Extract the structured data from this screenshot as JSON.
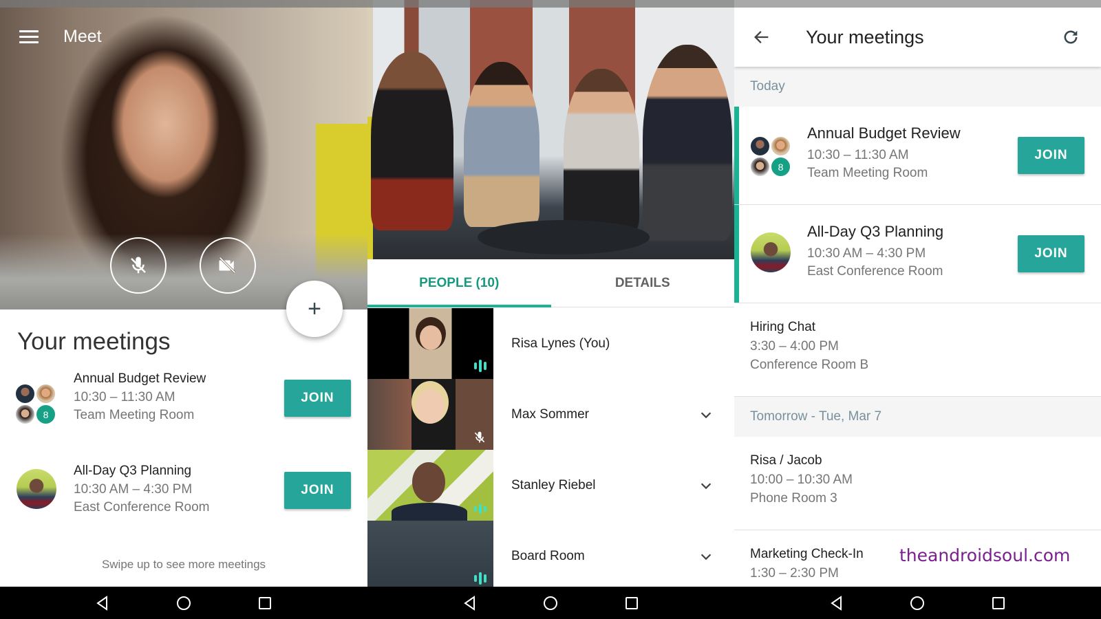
{
  "screen1": {
    "app_title": "Meet",
    "icons": {
      "menu": "hamburger-menu-icon",
      "mic": "mic-off-icon",
      "camera": "videocam-off-icon",
      "add": "plus-icon"
    },
    "fab_label": "+",
    "section_title": "Your meetings",
    "meetings": [
      {
        "title": "Annual Budget Review",
        "time": "10:30 – 11:30 AM",
        "room": "Team Meeting Room",
        "extra_participants": "8",
        "join_label": "JOIN"
      },
      {
        "title": "All-Day Q3 Planning",
        "time": "10:30 AM – 4:30 PM",
        "room": "East Conference Room",
        "join_label": "JOIN"
      }
    ],
    "swipe_hint": "Swipe up to see more meetings"
  },
  "screen2": {
    "tabs": [
      {
        "label": "PEOPLE (10)",
        "active": true
      },
      {
        "label": "DETAILS",
        "active": false
      }
    ],
    "people": [
      {
        "name": "Risa Lynes (You)",
        "status": "speaking",
        "expandable": false
      },
      {
        "name": "Max Sommer",
        "status": "muted",
        "expandable": true
      },
      {
        "name": "Stanley Riebel",
        "status": "speaking",
        "expandable": true
      },
      {
        "name": "Board Room",
        "status": "speaking",
        "expandable": true
      }
    ]
  },
  "screen3": {
    "title": "Your meetings",
    "icons": {
      "back": "arrow-back-icon",
      "refresh": "refresh-icon"
    },
    "sections": [
      {
        "header": "Today",
        "meetings": [
          {
            "title": "Annual Budget Review",
            "time": "10:30 – 11:30 AM",
            "room": "Team Meeting Room",
            "extra_participants": "8",
            "join_label": "JOIN"
          },
          {
            "title": "All-Day Q3 Planning",
            "time": "10:30 AM – 4:30 PM",
            "room": "East Conference Room",
            "join_label": "JOIN"
          },
          {
            "title": "Hiring Chat",
            "time": "3:30 – 4:00 PM",
            "room": "Conference Room B"
          }
        ]
      },
      {
        "header": "Tomorrow - Tue, Mar 7",
        "meetings": [
          {
            "title": "Risa / Jacob",
            "time": "10:00 – 10:30 AM",
            "room": "Phone Room 3"
          },
          {
            "title": "Marketing Check-In",
            "time": "1:30 – 2:30 PM",
            "room": ""
          }
        ]
      }
    ],
    "watermark": "theandroidsoul.com"
  },
  "colors": {
    "accent": "#26a69a",
    "tab_indicator": "#1ab394",
    "active_tab_text": "#16997f",
    "section_header_text": "#78909c",
    "watermark": "#7a1f8f"
  }
}
